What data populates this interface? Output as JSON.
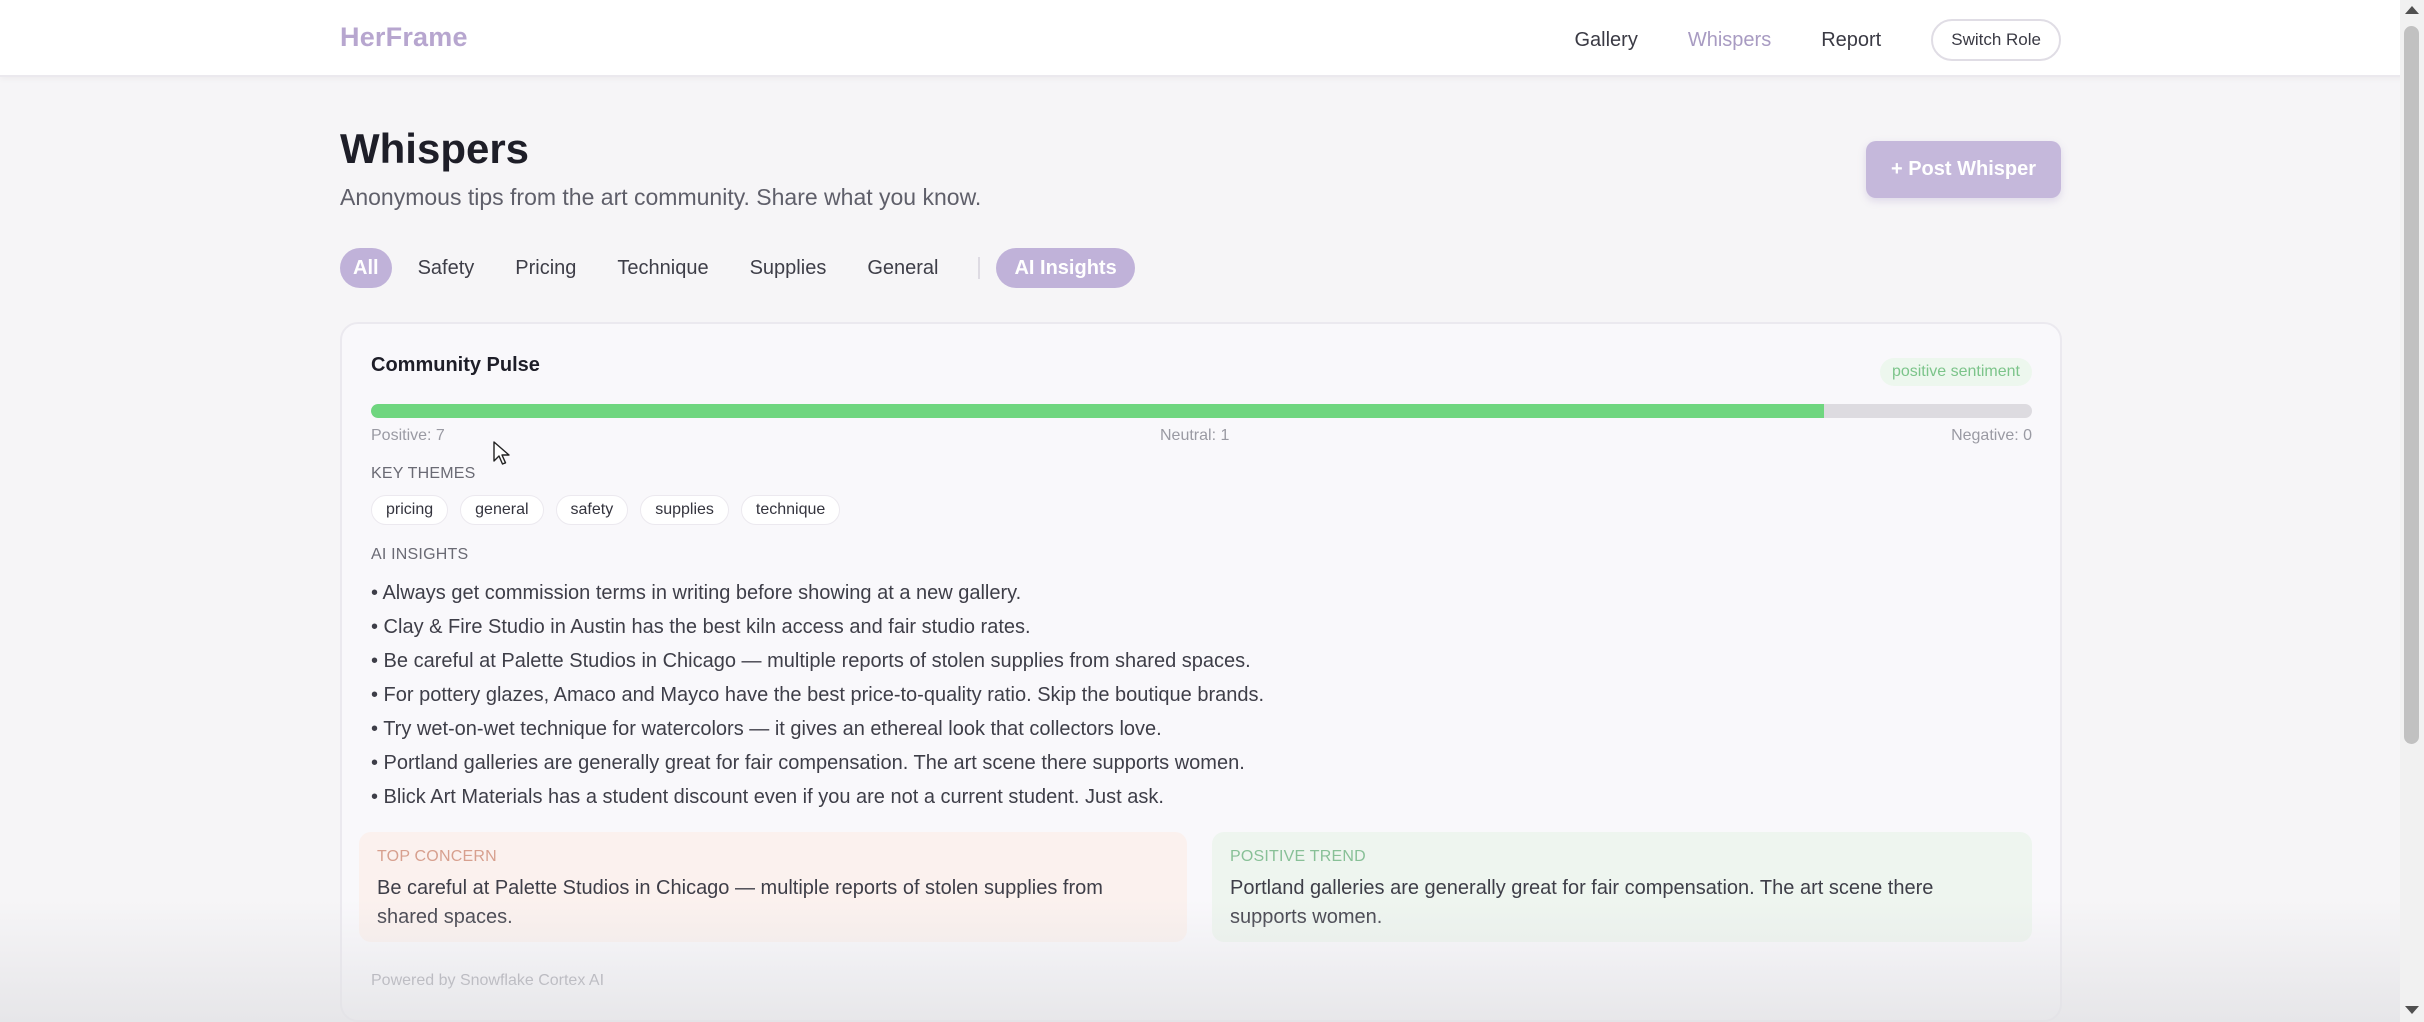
{
  "nav": {
    "brand": "HerFrame",
    "links": [
      "Gallery",
      "Whispers",
      "Report"
    ],
    "active_link": "Whispers",
    "switch_role_label": "Switch Role"
  },
  "page": {
    "title": "Whispers",
    "subtitle": "Anonymous tips from the art community. Share what you know.",
    "post_button_label": "+ Post Whisper"
  },
  "filters": {
    "chips": [
      "All",
      "Safety",
      "Pricing",
      "Technique",
      "Supplies",
      "General"
    ],
    "active": "All",
    "ai_insights_label": "AI Insights"
  },
  "pulse": {
    "title": "Community Pulse",
    "sentiment_label": "positive sentiment",
    "positive_label": "Positive: 7",
    "neutral_label": "Neutral: 1",
    "negative_label": "Negative: 0",
    "positive_fraction": 0.875,
    "key_themes_label": "KEY THEMES",
    "themes": [
      "pricing",
      "general",
      "safety",
      "supplies",
      "technique"
    ],
    "ai_insights_label": "AI INSIGHTS",
    "insights": [
      "• Always get commission terms in writing before showing at a new gallery.",
      "• Clay & Fire Studio in Austin has the best kiln access and fair studio rates.",
      "• Be careful at Palette Studios in Chicago — multiple reports of stolen supplies from shared spaces.",
      "• For pottery glazes, Amaco and Mayco have the best price-to-quality ratio. Skip the boutique brands.",
      "• Try wet-on-wet technique for watercolors — it gives an ethereal look that collectors love.",
      "• Portland galleries are generally great for fair compensation. The art scene there supports women.",
      "• Blick Art Materials has a student discount even if you are not a current student. Just ask."
    ],
    "top_concern_label": "TOP CONCERN",
    "top_concern_text": "Be careful at Palette Studios in Chicago — multiple reports of stolen supplies from shared spaces.",
    "positive_trend_label": "POSITIVE TREND",
    "positive_trend_text": "Portland galleries are generally great for fair compensation. The art scene there supports women.",
    "powered_by": "Powered by Snowflake Cortex AI"
  },
  "colors": {
    "accent": "#c0b2d9",
    "brand": "#b7a6cf",
    "positive_bar": "#6fd67f",
    "concern_bg": "#fbf1ee",
    "trend_bg": "#eef5ef"
  }
}
